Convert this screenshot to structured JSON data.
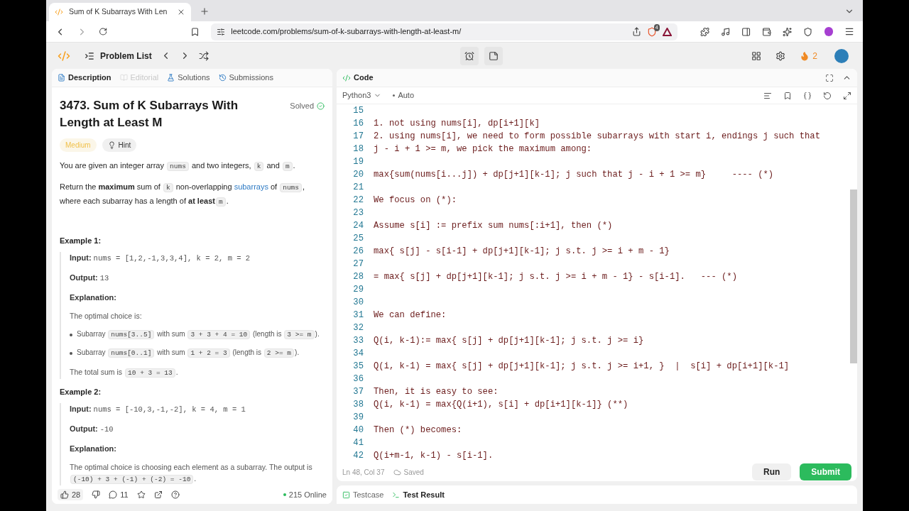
{
  "browser": {
    "tab_title": "Sum of K Subarrays With Len",
    "url": "leetcode.com/problems/sum-of-k-subarrays-with-length-at-least-m/",
    "shield_badge": "4"
  },
  "header": {
    "problem_list": "Problem List",
    "streak": "2"
  },
  "left_tabs": [
    {
      "label": "Description",
      "selected": true,
      "disabled": false
    },
    {
      "label": "Editorial",
      "selected": false,
      "disabled": true
    },
    {
      "label": "Solutions",
      "selected": false,
      "disabled": false
    },
    {
      "label": "Submissions",
      "selected": false,
      "disabled": false
    }
  ],
  "problem": {
    "title": "3473. Sum of K Subarrays With Length at Least M",
    "status": "Solved",
    "difficulty": "Medium",
    "hint": "Hint",
    "paragraphs": [
      [
        {
          "kind": "text",
          "text": "You are given an integer array "
        },
        {
          "kind": "code",
          "text": "nums"
        },
        {
          "kind": "text",
          "text": " and two integers, "
        },
        {
          "kind": "code",
          "text": "k"
        },
        {
          "kind": "text",
          "text": " and "
        },
        {
          "kind": "code",
          "text": "m"
        },
        {
          "kind": "text",
          "text": "."
        }
      ],
      [
        {
          "kind": "text",
          "text": "Return the "
        },
        {
          "kind": "bold",
          "text": "maximum"
        },
        {
          "kind": "text",
          "text": " sum of "
        },
        {
          "kind": "code",
          "text": "k"
        },
        {
          "kind": "text",
          "text": " non-overlapping "
        },
        {
          "kind": "link",
          "text": "subarrays"
        },
        {
          "kind": "text",
          "text": " of "
        },
        {
          "kind": "code",
          "text": "nums"
        },
        {
          "kind": "text",
          "text": ", where each subarray has a length of "
        },
        {
          "kind": "bold",
          "text": "at least"
        },
        {
          "kind": "code",
          "text": "m"
        },
        {
          "kind": "text",
          "text": "."
        }
      ]
    ],
    "examples": [
      {
        "title": "Example 1:",
        "items": [
          {
            "kind": "io",
            "label": "Input:",
            "value": "nums = [1,2,-1,3,3,4], k = 2, m = 2"
          },
          {
            "kind": "io",
            "label": "Output:",
            "value": "13"
          },
          {
            "kind": "heading",
            "label": "Explanation:"
          },
          {
            "kind": "text",
            "segments": [
              {
                "kind": "text",
                "text": "The optimal choice is:"
              }
            ]
          },
          {
            "kind": "bullet",
            "segments": [
              {
                "kind": "text",
                "text": "Subarray "
              },
              {
                "kind": "code",
                "text": "nums[3..5]"
              },
              {
                "kind": "text",
                "text": " with sum "
              },
              {
                "kind": "code",
                "text": "3 + 3 + 4 = 10"
              },
              {
                "kind": "text",
                "text": " (length is "
              },
              {
                "kind": "code",
                "text": "3 >= m"
              },
              {
                "kind": "text",
                "text": ")."
              }
            ]
          },
          {
            "kind": "bullet",
            "segments": [
              {
                "kind": "text",
                "text": "Subarray "
              },
              {
                "kind": "code",
                "text": "nums[0..1]"
              },
              {
                "kind": "text",
                "text": " with sum "
              },
              {
                "kind": "code",
                "text": "1 + 2 = 3"
              },
              {
                "kind": "text",
                "text": " (length is "
              },
              {
                "kind": "code",
                "text": "2 >= m"
              },
              {
                "kind": "text",
                "text": ")."
              }
            ]
          },
          {
            "kind": "text",
            "segments": [
              {
                "kind": "text",
                "text": "The total sum is "
              },
              {
                "kind": "code",
                "text": "10 + 3 = 13"
              },
              {
                "kind": "text",
                "text": "."
              }
            ]
          }
        ]
      },
      {
        "title": "Example 2:",
        "items": [
          {
            "kind": "io",
            "label": "Input:",
            "value": "nums = [-10,3,-1,-2], k = 4, m = 1"
          },
          {
            "kind": "io",
            "label": "Output:",
            "value": "-10"
          },
          {
            "kind": "heading",
            "label": "Explanation:"
          },
          {
            "kind": "text",
            "segments": [
              {
                "kind": "text",
                "text": "The optimal choice is choosing each element as a subarray. The output is "
              },
              {
                "kind": "code",
                "text": "(-10) + 3 + (-1) + (-2) = -10"
              },
              {
                "kind": "text",
                "text": "."
              }
            ]
          }
        ]
      }
    ]
  },
  "footer": {
    "likes": "28",
    "comments": "11",
    "online": "215 Online"
  },
  "code_panel": {
    "title": "Code",
    "language": "Python3",
    "mode": "Auto",
    "lines": [
      {
        "n": "15"
      },
      {
        "n": "16",
        "text": "1. not using nums[i], dp[i+1][k]"
      },
      {
        "n": "17",
        "text": "2. using nums[i], we need to form possible subarrays with start i, endings j such that"
      },
      {
        "n": "18",
        "text": "j - i + 1 >= m, we pick the maximum among:"
      },
      {
        "n": "19"
      },
      {
        "n": "20",
        "text": "max{sum(nums[i...j]) + dp[j+1][k-1]; j such that j - i + 1 >= m}     ---- (*)"
      },
      {
        "n": "21"
      },
      {
        "n": "22",
        "text": "We focus on (*):"
      },
      {
        "n": "23"
      },
      {
        "n": "24",
        "text": "Assume s[i] := prefix sum nums[:i+1], then (*)"
      },
      {
        "n": "25"
      },
      {
        "n": "26",
        "text": "max{ s[j] - s[i-1] + dp[j+1][k-1]; j s.t. j >= i + m - 1}"
      },
      {
        "n": "27"
      },
      {
        "n": "28",
        "text": "= max{ s[j] + dp[j+1][k-1]; j s.t. j >= i + m - 1} - s[i-1].   --- (*)"
      },
      {
        "n": "29"
      },
      {
        "n": "30"
      },
      {
        "n": "31",
        "text": "We can define:"
      },
      {
        "n": "32"
      },
      {
        "n": "33",
        "text": "Q(i, k-1):= max{ s[j] + dp[j+1][k-1]; j s.t. j >= i}"
      },
      {
        "n": "34"
      },
      {
        "n": "35",
        "text": "Q(i, k-1) = max{ s[j] + dp[j+1][k-1]; j s.t. j >= i+1, }  |  s[i] + dp[i+1][k-1]"
      },
      {
        "n": "36"
      },
      {
        "n": "37",
        "text": "Then, it is easy to see:"
      },
      {
        "n": "38",
        "text": "Q(i, k-1) = max{Q(i+1), s[i] + dp[i+1][k-1]} (**)"
      },
      {
        "n": "39"
      },
      {
        "n": "40",
        "text": "Then (*) becomes:"
      },
      {
        "n": "41"
      },
      {
        "n": "42",
        "text": "Q(i+m-1, k-1) - s[i-1]."
      }
    ],
    "cursor": "Ln 48, Col 37",
    "saved": "Saved",
    "run": "Run",
    "submit": "Submit"
  },
  "bottom_tabs": [
    {
      "label": "Testcase",
      "selected": false
    },
    {
      "label": "Test Result",
      "selected": true
    }
  ]
}
